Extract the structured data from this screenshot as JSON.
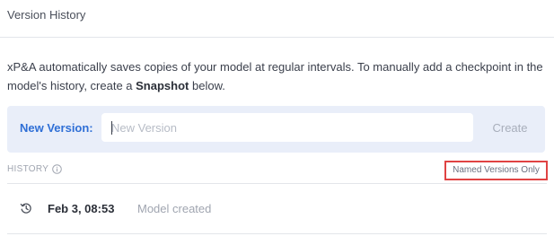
{
  "header": {
    "title": "Version History"
  },
  "description": {
    "text_before": "xP&A automatically saves copies of your model at regular intervals. To manually add a checkpoint in the model's history, create a ",
    "bold": "Snapshot",
    "text_after": " below."
  },
  "new_version": {
    "label": "New Version:",
    "input_value": "",
    "placeholder": "New Version",
    "create_label": "Create"
  },
  "history": {
    "label": "HISTORY",
    "info_icon": "info-icon",
    "filter_label": "Named Versions Only",
    "filter_highlight_color": "#e04343",
    "items": [
      {
        "icon": "history-icon",
        "date": "Feb 3, 08:53",
        "note": "Model created"
      }
    ]
  },
  "colors": {
    "accent": "#2f6fd6",
    "panel_bg": "#e9eef9"
  }
}
